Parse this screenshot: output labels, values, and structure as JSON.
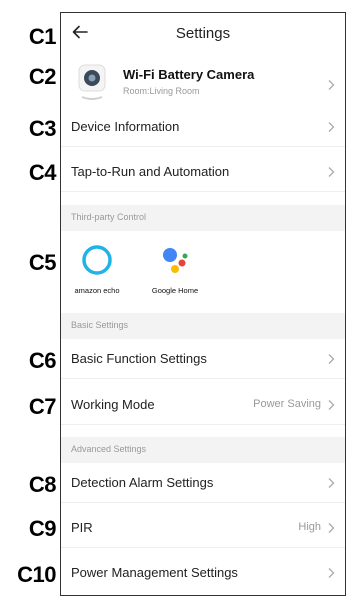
{
  "callouts": [
    "C1",
    "C2",
    "C3",
    "C4",
    "C5",
    "C6",
    "C7",
    "C8",
    "C9",
    "C10"
  ],
  "header": {
    "title": "Settings",
    "back_icon": "arrow-left-icon"
  },
  "device": {
    "name": "Wi-Fi Battery Camera",
    "room": "Room:Living Room"
  },
  "menu": {
    "device_information": "Device Information",
    "tap_to_run": "Tap-to-Run and Automation",
    "third_party_section": "Third-party Control",
    "amazon_echo": "amazon echo",
    "google_home": "Google Home",
    "basic_section": "Basic Settings",
    "basic_function": "Basic Function Settings",
    "working_mode": "Working Mode",
    "working_mode_value": "Power Saving",
    "advanced_section": "Advanced Settings",
    "detection_alarm": "Detection Alarm Settings",
    "pir": "PIR",
    "pir_value": "High",
    "power_management": "Power Management Settings"
  },
  "colors": {
    "section_bg": "#f3f3f3",
    "muted_text": "#999999",
    "echo_blue": "#1fb3e8"
  }
}
